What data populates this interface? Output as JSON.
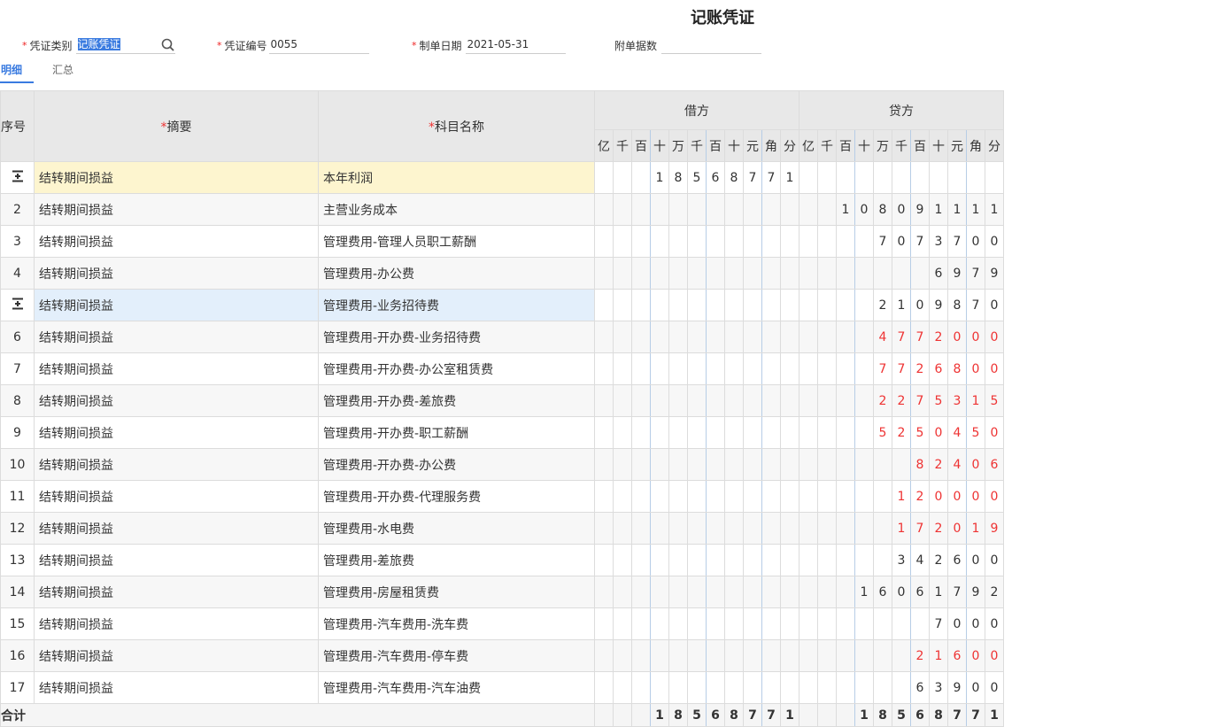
{
  "title": "记账凭证",
  "header": {
    "voucher_type_label": "凭证类别",
    "voucher_type_value": "记账凭证",
    "voucher_no_label": "凭证编号",
    "voucher_no_value": "0055",
    "date_label": "制单日期",
    "date_value": "2021-05-31",
    "attach_label": "附单据数",
    "attach_value": ""
  },
  "tabs": [
    {
      "label": "明细",
      "active": true
    },
    {
      "label": "汇总",
      "active": false
    }
  ],
  "table": {
    "col_seq": "序号",
    "col_summary": "摘要",
    "col_account": "科目名称",
    "col_debit": "借方",
    "col_credit": "贷方",
    "digit_headers": [
      "亿",
      "千",
      "百",
      "十",
      "万",
      "千",
      "百",
      "十",
      "元",
      "角",
      "分"
    ],
    "rows": [
      {
        "seq": "",
        "icon": "insert-row-icon",
        "summary": "结转期间损益",
        "account": "本年利润",
        "debit": "18568771",
        "credit": "",
        "red": false,
        "highlight": "yellow"
      },
      {
        "seq": "2",
        "summary": "结转期间损益",
        "account": "主营业务成本",
        "debit": "",
        "credit": "108091111",
        "red": false
      },
      {
        "seq": "3",
        "summary": "结转期间损益",
        "account": "管理费用-管理人员职工薪酬",
        "debit": "",
        "credit": "7073700",
        "red": false
      },
      {
        "seq": "4",
        "summary": "结转期间损益",
        "account": "管理费用-办公费",
        "debit": "",
        "credit": "6979",
        "red": false
      },
      {
        "seq": "",
        "icon": "insert-row-icon",
        "summary": "结转期间损益",
        "account": "管理费用-业务招待费",
        "debit": "",
        "credit": "2109870",
        "red": false,
        "highlight": "blue"
      },
      {
        "seq": "6",
        "summary": "结转期间损益",
        "account": "管理费用-开办费-业务招待费",
        "debit": "",
        "credit": "4772000",
        "red": true
      },
      {
        "seq": "7",
        "summary": "结转期间损益",
        "account": "管理费用-开办费-办公室租赁费",
        "debit": "",
        "credit": "7726800",
        "red": true
      },
      {
        "seq": "8",
        "summary": "结转期间损益",
        "account": "管理费用-开办费-差旅费",
        "debit": "",
        "credit": "2275315",
        "red": true
      },
      {
        "seq": "9",
        "summary": "结转期间损益",
        "account": "管理费用-开办费-职工薪酬",
        "debit": "",
        "credit": "5250450",
        "red": true
      },
      {
        "seq": "10",
        "summary": "结转期间损益",
        "account": "管理费用-开办费-办公费",
        "debit": "",
        "credit": "82406",
        "red": true
      },
      {
        "seq": "11",
        "summary": "结转期间损益",
        "account": "管理费用-开办费-代理服务费",
        "debit": "",
        "credit": "120000",
        "red": true
      },
      {
        "seq": "12",
        "summary": "结转期间损益",
        "account": "管理费用-水电费",
        "debit": "",
        "credit": "172019",
        "red": true
      },
      {
        "seq": "13",
        "summary": "结转期间损益",
        "account": "管理费用-差旅费",
        "debit": "",
        "credit": "342600",
        "red": false
      },
      {
        "seq": "14",
        "summary": "结转期间损益",
        "account": "管理费用-房屋租赁费",
        "debit": "",
        "credit": "16061792",
        "red": false
      },
      {
        "seq": "15",
        "summary": "结转期间损益",
        "account": "管理费用-汽车费用-洗车费",
        "debit": "",
        "credit": "7000",
        "red": false
      },
      {
        "seq": "16",
        "summary": "结转期间损益",
        "account": "管理费用-汽车费用-停车费",
        "debit": "",
        "credit": "21600",
        "red": true
      },
      {
        "seq": "17",
        "summary": "结转期间损益",
        "account": "管理费用-汽车费用-汽车油费",
        "debit": "",
        "credit": "63900",
        "red": false
      }
    ],
    "total_label": "合计",
    "total_debit": "18568771",
    "total_credit": "18568771"
  }
}
